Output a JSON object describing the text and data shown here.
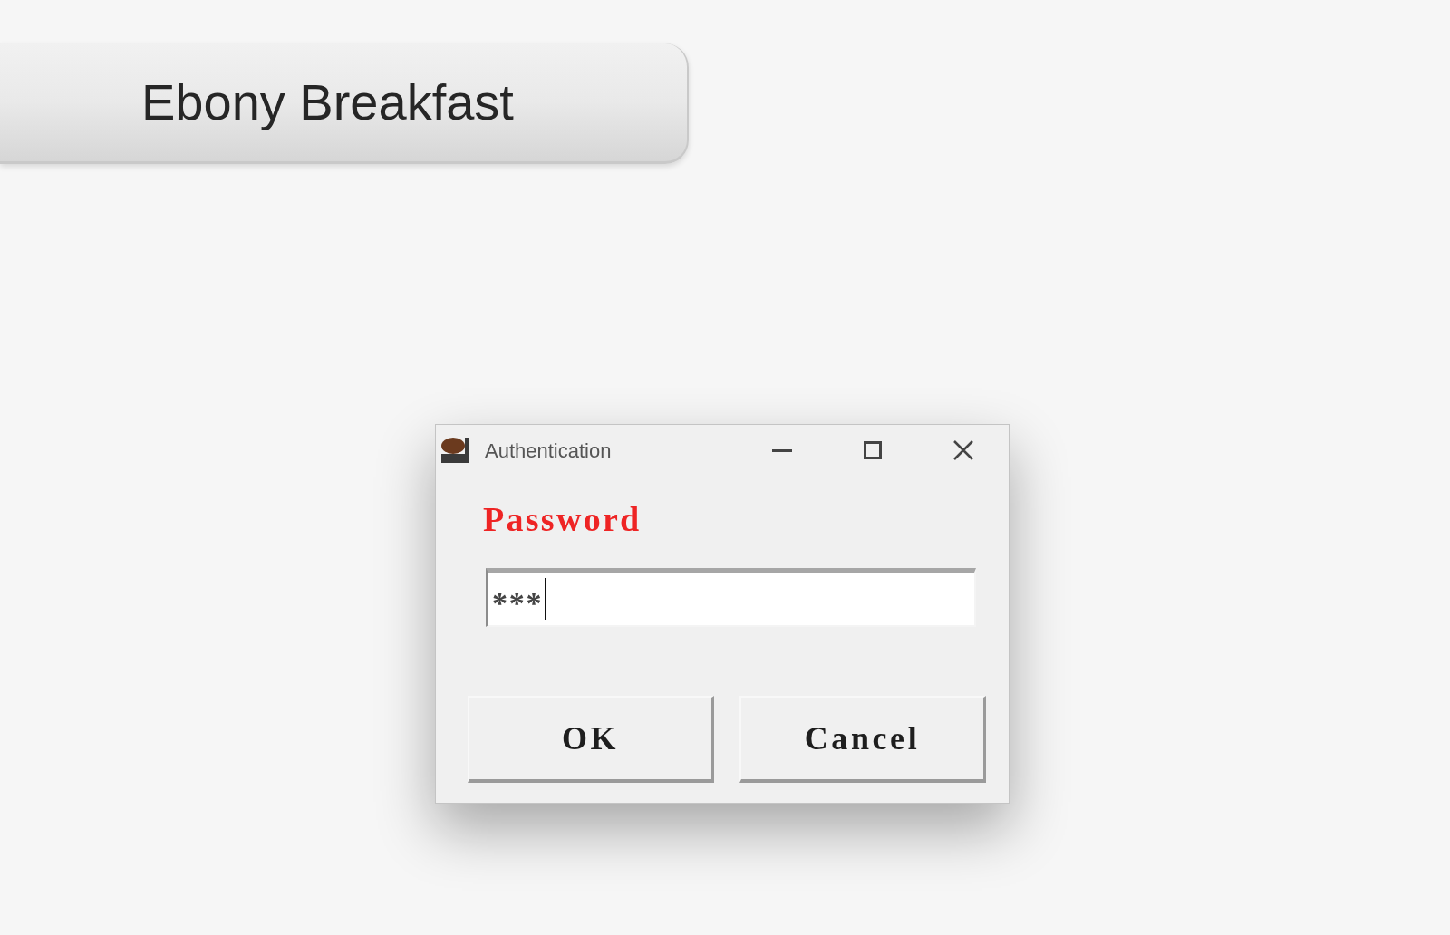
{
  "top_button": {
    "label": "Ebony Breakfast"
  },
  "dialog": {
    "title": "Authentication",
    "field_label": "Password",
    "password_field": {
      "value": "***",
      "focused": true
    },
    "buttons": [
      "OK",
      "Cancel"
    ]
  }
}
